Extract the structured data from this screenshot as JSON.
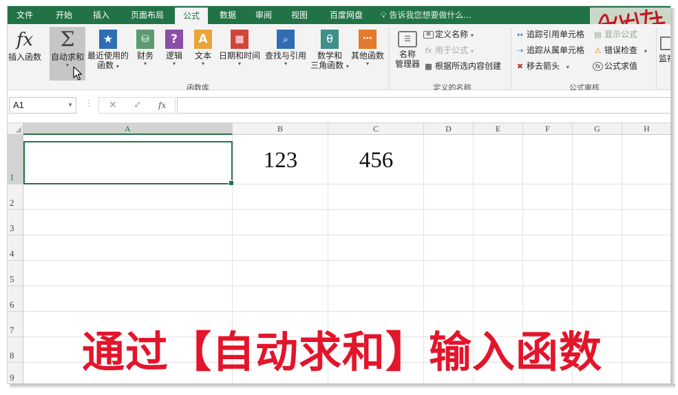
{
  "tabs": [
    {
      "label": "文件",
      "active": false
    },
    {
      "label": "开始",
      "active": false
    },
    {
      "label": "插入",
      "active": false
    },
    {
      "label": "页面布局",
      "active": false
    },
    {
      "label": "公式",
      "active": true
    },
    {
      "label": "数据",
      "active": false
    },
    {
      "label": "审阅",
      "active": false
    },
    {
      "label": "视图",
      "active": false
    },
    {
      "label": "百度网盘",
      "active": false
    }
  ],
  "tell_me": "告诉我您想要做什么...",
  "ribbon": {
    "function_library": {
      "insert_function": "插入函数",
      "autosum": "自动求和",
      "recently_used_line1": "最近使用的",
      "recently_used_line2": "函数",
      "financial": "财务",
      "logical": "逻辑",
      "text": "文本",
      "date_time": "日期和时间",
      "lookup": "查找与引用",
      "math_line1": "数学和",
      "math_line2": "三角函数",
      "more_functions": "其他函数",
      "group_label": "函数库"
    },
    "defined_names": {
      "name_manager_line1": "名称",
      "name_manager_line2": "管理器",
      "define_name": "定义名称",
      "use_in_formula": "用于公式",
      "create_from_selection": "根据所选内容创建",
      "group_label": "定义的名称"
    },
    "formula_auditing": {
      "trace_precedents": "追踪引用单元格",
      "trace_dependents": "追踪从属单元格",
      "remove_arrows": "移去箭头",
      "show_formulas": "显示公式",
      "error_checking": "错误检查",
      "evaluate_formula": "公式求值",
      "watch_partial": "监视",
      "group_label": "公式审核"
    }
  },
  "formula_bar": {
    "name_box": "A1",
    "fx_label": "fx",
    "formula": ""
  },
  "grid": {
    "columns": [
      "A",
      "B",
      "C",
      "D",
      "E",
      "F",
      "G",
      "H"
    ],
    "rows": [
      "1",
      "2",
      "3",
      "4",
      "5",
      "6",
      "7",
      "8",
      "9"
    ],
    "cells": {
      "B1": "123",
      "C1": "456"
    },
    "selected_cell": "A1"
  },
  "caption": "通过【自动求和】输入函数",
  "colors": {
    "excel_green": "#217346",
    "caption_red": "#e3152b"
  }
}
